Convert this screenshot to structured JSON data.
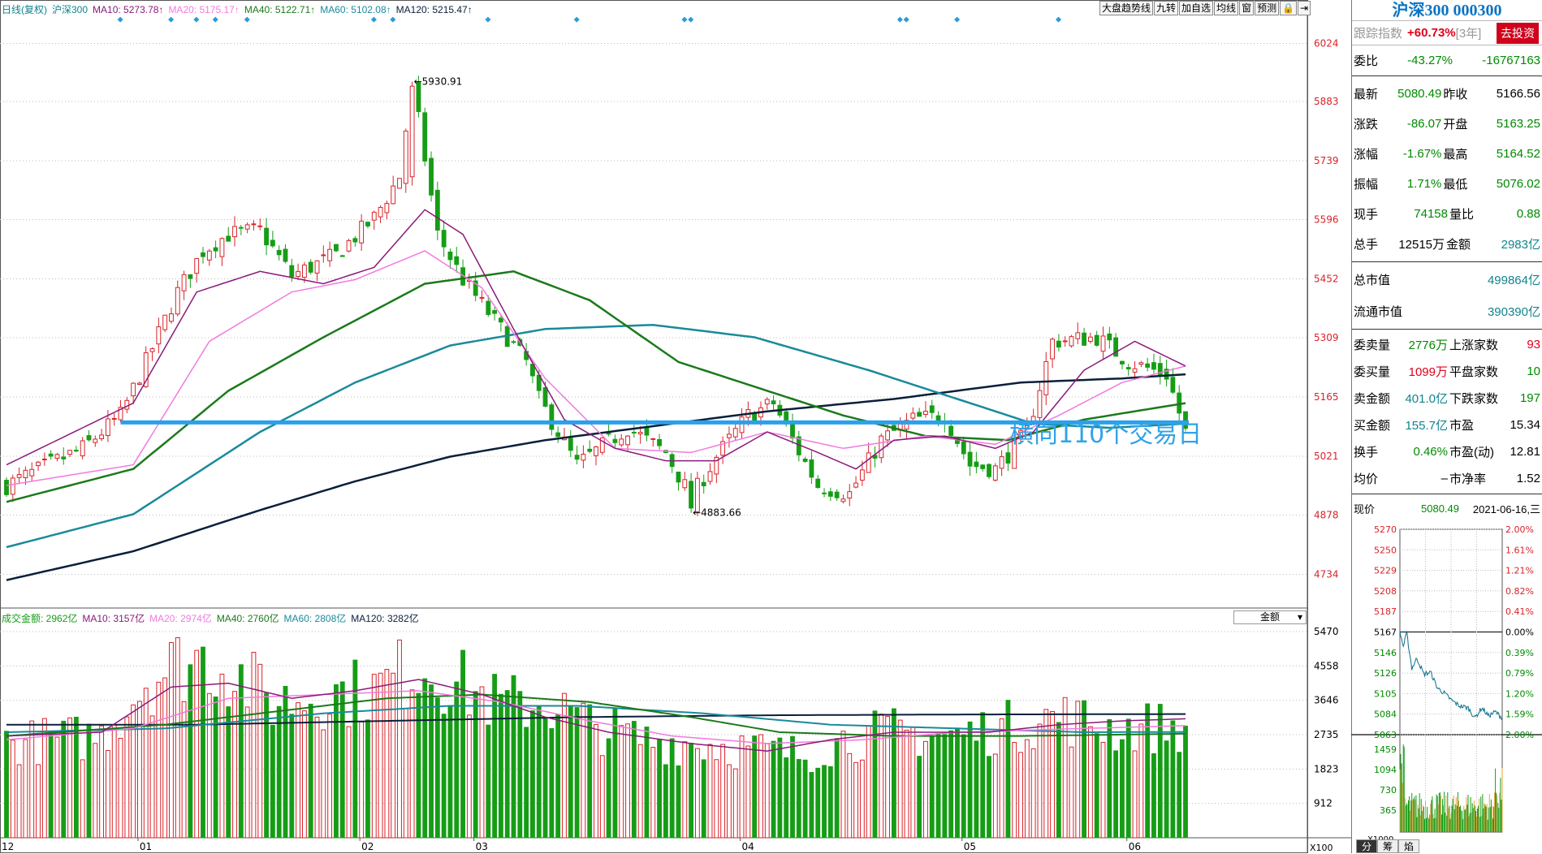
{
  "header": {
    "kline_label": "日线(复权)",
    "index_name": "沪深300",
    "ma": [
      {
        "label": "MA10: 5273.78↑",
        "color": "#8b1a7a"
      },
      {
        "label": "MA20: 5175.17↑",
        "color": "#f27ae0"
      },
      {
        "label": "MA40: 5122.71↑",
        "color": "#1b7a1b"
      },
      {
        "label": "MA60: 5102.08↑",
        "color": "#1a8a9a"
      },
      {
        "label": "MA120: 5215.47↑",
        "color": "#0b1f3a"
      }
    ]
  },
  "toolbar": [
    "大盘趋势线",
    "九转",
    "加自选",
    "均线",
    "窗",
    "预测",
    "🔒",
    "⇥"
  ],
  "price_axis_labels": [
    "6024",
    "5883",
    "5739",
    "5596",
    "5452",
    "5309",
    "5165",
    "5021",
    "4878",
    "4734"
  ],
  "volume_axis_labels": [
    "5470",
    "4558",
    "3646",
    "2735",
    "1823",
    "912"
  ],
  "volume_axis_unit": "X100",
  "date_labels": [
    "12",
    "01",
    "02",
    "03",
    "04",
    "05",
    "06"
  ],
  "annotations": {
    "high": "5930.91",
    "low": "4883.66",
    "big": "横向110个交易日"
  },
  "volume_header": {
    "label": "成交金额: 2962亿",
    "ma": [
      {
        "label": "MA10: 3157亿",
        "color": "#8b1a7a"
      },
      {
        "label": "MA20: 2974亿",
        "color": "#f27ae0"
      },
      {
        "label": "MA40: 2760亿",
        "color": "#1b7a1b"
      },
      {
        "label": "MA60: 2808亿",
        "color": "#1a8a9a"
      },
      {
        "label": "MA120: 3282亿",
        "color": "#0b1f3a"
      }
    ],
    "select": "金额"
  },
  "chart_data": {
    "type": "candlestick",
    "title": "沪深300 000300",
    "ylim": [
      4660,
      6090
    ],
    "high_marker": 5930.91,
    "low_marker": 4883.66,
    "horizontal_line_level": 5103,
    "colors": {
      "up": "#d8232a",
      "down": "#169d16",
      "ma10": "#8b1a7a",
      "ma20": "#f27ae0",
      "ma40": "#1b7a1b",
      "ma60": "#1a8a9a",
      "ma120": "#0b1f3a",
      "hline": "#2aa0ee"
    },
    "keypoints": [
      [
        0,
        4950
      ],
      [
        12,
        5040
      ],
      [
        18,
        5120
      ],
      [
        22,
        5250
      ],
      [
        27,
        5420
      ],
      [
        31,
        5520
      ],
      [
        35,
        5560
      ],
      [
        40,
        5570
      ],
      [
        45,
        5460
      ],
      [
        52,
        5510
      ],
      [
        58,
        5600
      ],
      [
        62,
        5700
      ],
      [
        64,
        5930
      ],
      [
        68,
        5560
      ],
      [
        72,
        5450
      ],
      [
        77,
        5350
      ],
      [
        82,
        5250
      ],
      [
        84,
        5160
      ],
      [
        90,
        5000
      ],
      [
        98,
        5090
      ],
      [
        104,
        5030
      ],
      [
        108,
        4920
      ],
      [
        112,
        5020
      ],
      [
        117,
        5120
      ],
      [
        121,
        5150
      ],
      [
        124,
        5060
      ],
      [
        128,
        4950
      ],
      [
        133,
        4930
      ],
      [
        138,
        5060
      ],
      [
        143,
        5110
      ],
      [
        148,
        5120
      ],
      [
        152,
        5000
      ],
      [
        156,
        4990
      ],
      [
        161,
        5080
      ],
      [
        165,
        5300
      ],
      [
        172,
        5310
      ],
      [
        177,
        5250
      ],
      [
        183,
        5220
      ],
      [
        186,
        5080
      ]
    ],
    "ma_keypoints": {
      "ma10": [
        [
          0,
          5000
        ],
        [
          20,
          5150
        ],
        [
          30,
          5420
        ],
        [
          40,
          5470
        ],
        [
          50,
          5440
        ],
        [
          58,
          5480
        ],
        [
          66,
          5620
        ],
        [
          72,
          5560
        ],
        [
          80,
          5330
        ],
        [
          88,
          5110
        ],
        [
          96,
          5040
        ],
        [
          104,
          5010
        ],
        [
          112,
          5010
        ],
        [
          120,
          5080
        ],
        [
          128,
          5030
        ],
        [
          134,
          4990
        ],
        [
          140,
          5060
        ],
        [
          148,
          5070
        ],
        [
          156,
          5040
        ],
        [
          162,
          5080
        ],
        [
          170,
          5230
        ],
        [
          178,
          5300
        ],
        [
          186,
          5240
        ]
      ],
      "ma20": [
        [
          0,
          4950
        ],
        [
          20,
          5000
        ],
        [
          32,
          5300
        ],
        [
          45,
          5420
        ],
        [
          55,
          5450
        ],
        [
          66,
          5520
        ],
        [
          75,
          5430
        ],
        [
          85,
          5210
        ],
        [
          96,
          5040
        ],
        [
          108,
          5030
        ],
        [
          120,
          5080
        ],
        [
          132,
          5040
        ],
        [
          145,
          5070
        ],
        [
          156,
          5050
        ],
        [
          166,
          5120
        ],
        [
          176,
          5200
        ],
        [
          186,
          5240
        ]
      ],
      "ma40": [
        [
          0,
          4910
        ],
        [
          20,
          4990
        ],
        [
          35,
          5180
        ],
        [
          50,
          5310
        ],
        [
          66,
          5440
        ],
        [
          80,
          5470
        ],
        [
          92,
          5400
        ],
        [
          106,
          5250
        ],
        [
          120,
          5180
        ],
        [
          132,
          5120
        ],
        [
          145,
          5070
        ],
        [
          158,
          5060
        ],
        [
          170,
          5110
        ],
        [
          186,
          5150
        ]
      ],
      "ma60": [
        [
          0,
          4800
        ],
        [
          20,
          4880
        ],
        [
          40,
          5080
        ],
        [
          55,
          5200
        ],
        [
          70,
          5290
        ],
        [
          85,
          5330
        ],
        [
          102,
          5340
        ],
        [
          118,
          5310
        ],
        [
          136,
          5230
        ],
        [
          150,
          5160
        ],
        [
          162,
          5100
        ],
        [
          174,
          5090
        ],
        [
          186,
          5100
        ]
      ],
      "ma120": [
        [
          0,
          4720
        ],
        [
          20,
          4790
        ],
        [
          40,
          4890
        ],
        [
          55,
          4960
        ],
        [
          70,
          5020
        ],
        [
          85,
          5060
        ],
        [
          100,
          5090
        ],
        [
          120,
          5130
        ],
        [
          140,
          5160
        ],
        [
          160,
          5200
        ],
        [
          176,
          5210
        ],
        [
          186,
          5220
        ]
      ]
    },
    "volume_ylim": [
      0,
      5470
    ],
    "volume_keypoints": [
      [
        0,
        2500
      ],
      [
        15,
        2700
      ],
      [
        22,
        4200
      ],
      [
        30,
        4800
      ],
      [
        35,
        4500
      ],
      [
        42,
        3600
      ],
      [
        50,
        3800
      ],
      [
        58,
        3900
      ],
      [
        65,
        4600
      ],
      [
        70,
        4200
      ],
      [
        78,
        3500
      ],
      [
        85,
        3600
      ],
      [
        92,
        3000
      ],
      [
        100,
        2600
      ],
      [
        110,
        2500
      ],
      [
        120,
        2300
      ],
      [
        126,
        2200
      ],
      [
        132,
        2600
      ],
      [
        140,
        2800
      ],
      [
        150,
        2700
      ],
      [
        160,
        3000
      ],
      [
        166,
        3200
      ],
      [
        175,
        2900
      ],
      [
        186,
        2962
      ]
    ],
    "volume_ma_keypoints": {
      "ma10": [
        [
          0,
          2700
        ],
        [
          15,
          2800
        ],
        [
          26,
          4000
        ],
        [
          35,
          4100
        ],
        [
          45,
          3700
        ],
        [
          55,
          3900
        ],
        [
          65,
          4200
        ],
        [
          75,
          3800
        ],
        [
          85,
          3200
        ],
        [
          95,
          2800
        ],
        [
          108,
          2500
        ],
        [
          120,
          2300
        ],
        [
          130,
          2600
        ],
        [
          140,
          2800
        ],
        [
          155,
          2800
        ],
        [
          166,
          3000
        ],
        [
          176,
          3100
        ],
        [
          186,
          3157
        ]
      ],
      "ma20": [
        [
          0,
          2600
        ],
        [
          20,
          2900
        ],
        [
          35,
          3700
        ],
        [
          50,
          3800
        ],
        [
          65,
          3900
        ],
        [
          78,
          3600
        ],
        [
          92,
          3100
        ],
        [
          105,
          2700
        ],
        [
          120,
          2500
        ],
        [
          135,
          2600
        ],
        [
          150,
          2800
        ],
        [
          170,
          2900
        ],
        [
          186,
          2974
        ]
      ],
      "ma40": [
        [
          0,
          2700
        ],
        [
          25,
          3000
        ],
        [
          45,
          3400
        ],
        [
          60,
          3700
        ],
        [
          75,
          3800
        ],
        [
          92,
          3600
        ],
        [
          108,
          3200
        ],
        [
          122,
          2800
        ],
        [
          140,
          2700
        ],
        [
          160,
          2700
        ],
        [
          186,
          2760
        ]
      ],
      "ma60": [
        [
          0,
          2800
        ],
        [
          25,
          2900
        ],
        [
          50,
          3300
        ],
        [
          70,
          3500
        ],
        [
          90,
          3500
        ],
        [
          110,
          3300
        ],
        [
          130,
          3000
        ],
        [
          150,
          2900
        ],
        [
          170,
          2800
        ],
        [
          186,
          2808
        ]
      ],
      "ma120": [
        [
          0,
          3000
        ],
        [
          30,
          3000
        ],
        [
          60,
          3100
        ],
        [
          90,
          3200
        ],
        [
          120,
          3250
        ],
        [
          150,
          3270
        ],
        [
          186,
          3282
        ]
      ]
    },
    "intraday": {
      "price_labels": [
        "5270",
        "5250",
        "5229",
        "5208",
        "5187",
        "5167",
        "5146",
        "5126",
        "5105",
        "5084",
        "5063"
      ],
      "pct_labels": [
        "2.00%",
        "1.61%",
        "1.21%",
        "0.82%",
        "0.41%",
        "0.00%",
        "0.39%",
        "0.79%",
        "1.20%",
        "1.59%",
        "2.00%"
      ],
      "vol_labels": [
        "1459",
        "1094",
        "730",
        "365"
      ],
      "vol_unit": "X1000",
      "prev_close": 5166.56,
      "ylim": [
        5063,
        5270
      ]
    }
  },
  "panel": {
    "title": "沪深300 000300",
    "track": {
      "label": "跟踪指数",
      "pct": "+60.73%",
      "years": "[3年]",
      "button": "去投资"
    },
    "weibi": {
      "label": "委比",
      "pct": "-43.27%",
      "val": "-16767163"
    },
    "quote": [
      {
        "l1": "最新",
        "v1": "5080.49",
        "c1": "green",
        "l2": "昨收",
        "v2": "5166.56",
        "c2": "blk"
      },
      {
        "l1": "涨跌",
        "v1": "-86.07",
        "c1": "green",
        "l2": "开盘",
        "v2": "5163.25",
        "c2": "green"
      },
      {
        "l1": "涨幅",
        "v1": "-1.67%",
        "c1": "green",
        "l2": "最高",
        "v2": "5164.52",
        "c2": "green"
      },
      {
        "l1": "振幅",
        "v1": "1.71%",
        "c1": "green",
        "l2": "最低",
        "v2": "5076.02",
        "c2": "green"
      },
      {
        "l1": "现手",
        "v1": "74158",
        "c1": "green",
        "l2": "量比",
        "v2": "0.88",
        "c2": "green"
      },
      {
        "l1": "总手",
        "v1": "12515万",
        "c1": "blk",
        "l2": "金额",
        "v2": "2983亿",
        "c2": "teal"
      }
    ],
    "mcap": [
      {
        "label": "总市值",
        "val": "499864亿"
      },
      {
        "label": "流通市值",
        "val": "390390亿"
      }
    ],
    "stats": [
      {
        "l1": "委卖量",
        "v1": "2776万",
        "c1": "green",
        "l2": "上涨家数",
        "v2": "93",
        "c2": "red"
      },
      {
        "l1": "委买量",
        "v1": "1099万",
        "c1": "red",
        "l2": "平盘家数",
        "v2": "10",
        "c2": "green"
      },
      {
        "l1": "卖金额",
        "v1": "401.0亿",
        "c1": "teal",
        "l2": "下跌家数",
        "v2": "197",
        "c2": "green"
      },
      {
        "l1": "买金额",
        "v1": "155.7亿",
        "c1": "teal",
        "l2": "市盈",
        "v2": "15.34",
        "c2": "blk"
      },
      {
        "l1": "换手",
        "v1": "0.46%",
        "c1": "green",
        "l2": "市盈(动)",
        "v2": "12.81",
        "c2": "blk"
      },
      {
        "l1": "均价",
        "v1": "–",
        "c1": "blk",
        "l2": "市净率",
        "v2": "1.52",
        "c2": "blk"
      }
    ],
    "now": {
      "label": "现价",
      "price": "5080.49",
      "date": "2021-06-16,三"
    },
    "tabs": [
      "分",
      "筹",
      "焰"
    ]
  }
}
